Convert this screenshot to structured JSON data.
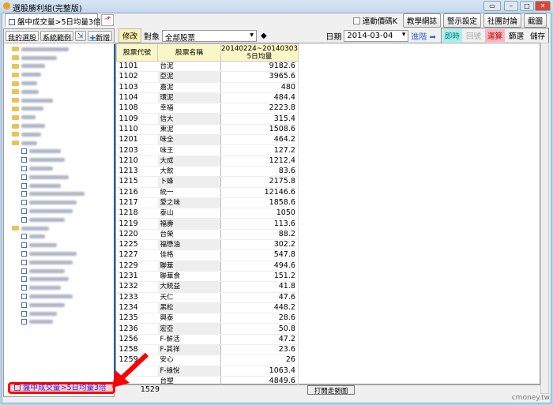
{
  "window": {
    "title": "選股勝利組(完整版)"
  },
  "tab": {
    "label": "盤中成交量>5日均量3倍"
  },
  "top_buttons": {
    "sync_k": "連動價碼K",
    "teaching": "教學網誌",
    "alert": "警示設定",
    "community": "社團討論",
    "screenshot": "截圖"
  },
  "left": {
    "my_stocks": "我的選股",
    "system_examples": "系統範例",
    "add": "新增",
    "selected": "盤中成交量>5日均量3倍"
  },
  "toolbar": {
    "edit": "修改",
    "target_label": "對象",
    "target_value": "全部股票",
    "date_label": "日期",
    "date_value": "2014-03-04",
    "backtrack": "進階",
    "realtime": "即時",
    "cancel": "回號",
    "calc": "運算",
    "filter": "篩選",
    "save": "儲存"
  },
  "table": {
    "headers": [
      "股票代號",
      "股票名稱",
      "20140224~20140303\n5日均量"
    ],
    "rows": [
      [
        "1101",
        "台泥",
        "9182.6"
      ],
      [
        "1102",
        "亞泥",
        "3965.6"
      ],
      [
        "1103",
        "嘉泥",
        "480"
      ],
      [
        "1104",
        "環泥",
        "484.4"
      ],
      [
        "1108",
        "幸福",
        "2223.8"
      ],
      [
        "1109",
        "信大",
        "315.4"
      ],
      [
        "1110",
        "東泥",
        "1508.6"
      ],
      [
        "1201",
        "味全",
        "464.2"
      ],
      [
        "1203",
        "味王",
        "127.2"
      ],
      [
        "1210",
        "大成",
        "1212.4"
      ],
      [
        "1213",
        "大飲",
        "83.6"
      ],
      [
        "1215",
        "卜蜂",
        "2175.8"
      ],
      [
        "1216",
        "統一",
        "12146.6"
      ],
      [
        "1217",
        "愛之味",
        "1858.6"
      ],
      [
        "1218",
        "泰山",
        "1050"
      ],
      [
        "1219",
        "福壽",
        "113.6"
      ],
      [
        "1220",
        "台榮",
        "88.2"
      ],
      [
        "1225",
        "福懋油",
        "302.2"
      ],
      [
        "1227",
        "佳格",
        "547.8"
      ],
      [
        "1229",
        "聯華",
        "494.6"
      ],
      [
        "1231",
        "聯華食",
        "151.2"
      ],
      [
        "1232",
        "大統益",
        "41.8"
      ],
      [
        "1233",
        "天仁",
        "47.6"
      ],
      [
        "1234",
        "黑松",
        "448.2"
      ],
      [
        "1235",
        "興泰",
        "28.6"
      ],
      [
        "1236",
        "宏亞",
        "50.8"
      ],
      [
        "1256",
        "F-鮮活",
        "47.2"
      ],
      [
        "1258",
        "F-其祥",
        "23.6"
      ],
      [
        "1259",
        "安心",
        "26"
      ],
      [
        "",
        "F-綠悅",
        "1063.4"
      ],
      [
        "",
        "台塑",
        "4849.6"
      ]
    ]
  },
  "footer": {
    "count": "1529",
    "open_chart": "打開走勢圖"
  },
  "watermark": "cmoney.tw"
}
